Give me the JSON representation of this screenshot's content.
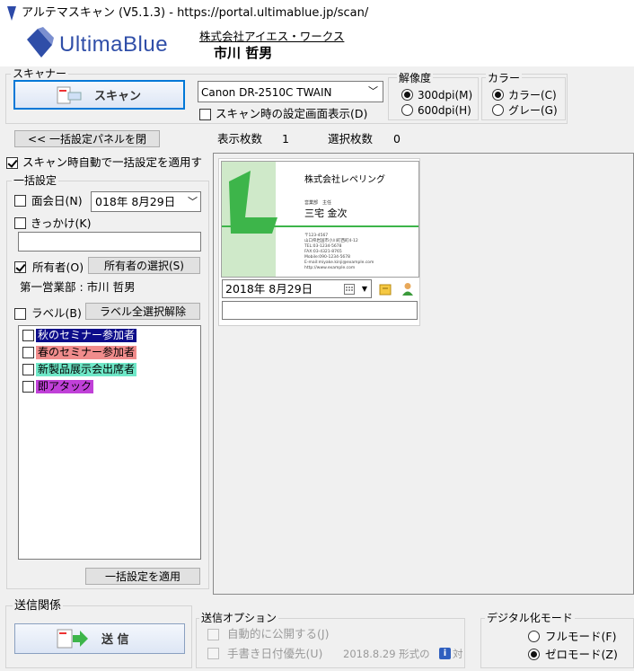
{
  "window": {
    "title": "アルテマスキャン (V5.1.3) - https://portal.ultimablue.jp/scan/"
  },
  "header": {
    "logo_text": "UltimaBlue",
    "company": "株式会社アイエス・ワークス",
    "user_name": "市川 哲男"
  },
  "scanner": {
    "group_label": "スキャナー",
    "scan_button": "スキャン",
    "device": "Canon DR-2510C TWAIN",
    "show_settings": "スキャン時の設定画面表示(D)",
    "resolution_label": "解像度",
    "res_300": "300dpi(M)",
    "res_600": "600dpi(H)",
    "color_label": "カラー",
    "color_color": "カラー(C)",
    "color_gray": "グレー(G)"
  },
  "bulk": {
    "close_panel": "<< 一括設定パネルを閉",
    "auto_apply": "スキャン時自動で一括設定を適用す",
    "group_label": "一括設定",
    "meeting_date_label": "面会日(N)",
    "meeting_date_value": "018年 8月29日",
    "trigger_label": "きっかけ(K)",
    "owner_label": "所有者(O)",
    "owner_select": "所有者の選択(S)",
    "owner_value": "第一営業部 : 市川 哲男",
    "label_label": "ラベル(B)",
    "label_clear": "ラベル全選択解除",
    "labels": [
      {
        "name": "秋のセミナー参加者",
        "color": "#0c0c8a",
        "text_color": "#ffffff"
      },
      {
        "name": "春のセミナー参加者",
        "color": "#f08c8c",
        "text_color": "#000000"
      },
      {
        "name": "新製品展示会出席者",
        "color": "#6fe8c8",
        "text_color": "#000000"
      },
      {
        "name": "即アタック",
        "color": "#c040d8",
        "text_color": "#000000"
      }
    ],
    "apply_button": "一括設定を適用"
  },
  "status": {
    "display_count_label": "表示枚数",
    "display_count": "1",
    "selected_count_label": "選択枚数",
    "selected_count": "0"
  },
  "card": {
    "company": "株式会社レペリング",
    "title": "営業部　主任",
    "name": "三宅 金次",
    "date": "2018年 8月29日",
    "details": [
      "〒123-4567",
      "山口県岩国市小川町西町4-12",
      "TEL:03-1234-5678",
      "FAX:03-4321-8765",
      "Mobile:090-1234-5678",
      "E-mail:miyake.kinji@example.com",
      "http://www.example.com"
    ]
  },
  "send": {
    "group_label": "送信関係",
    "send_button": "送 信",
    "options_label": "送信オプション",
    "auto_publish": "自動的に公開する(J)",
    "handwritten_date": "手書き日付優先(U)",
    "date_format": "2018.8.29 形式の",
    "info_suffix": "対"
  },
  "digital": {
    "group_label": "デジタル化モード",
    "full_mode": "フルモード(F)",
    "zero_mode": "ゼロモード(Z)"
  },
  "colors": {
    "brand_blue": "#2f4ea8",
    "card_green": "#3db54a",
    "selection": "#0078d7"
  }
}
